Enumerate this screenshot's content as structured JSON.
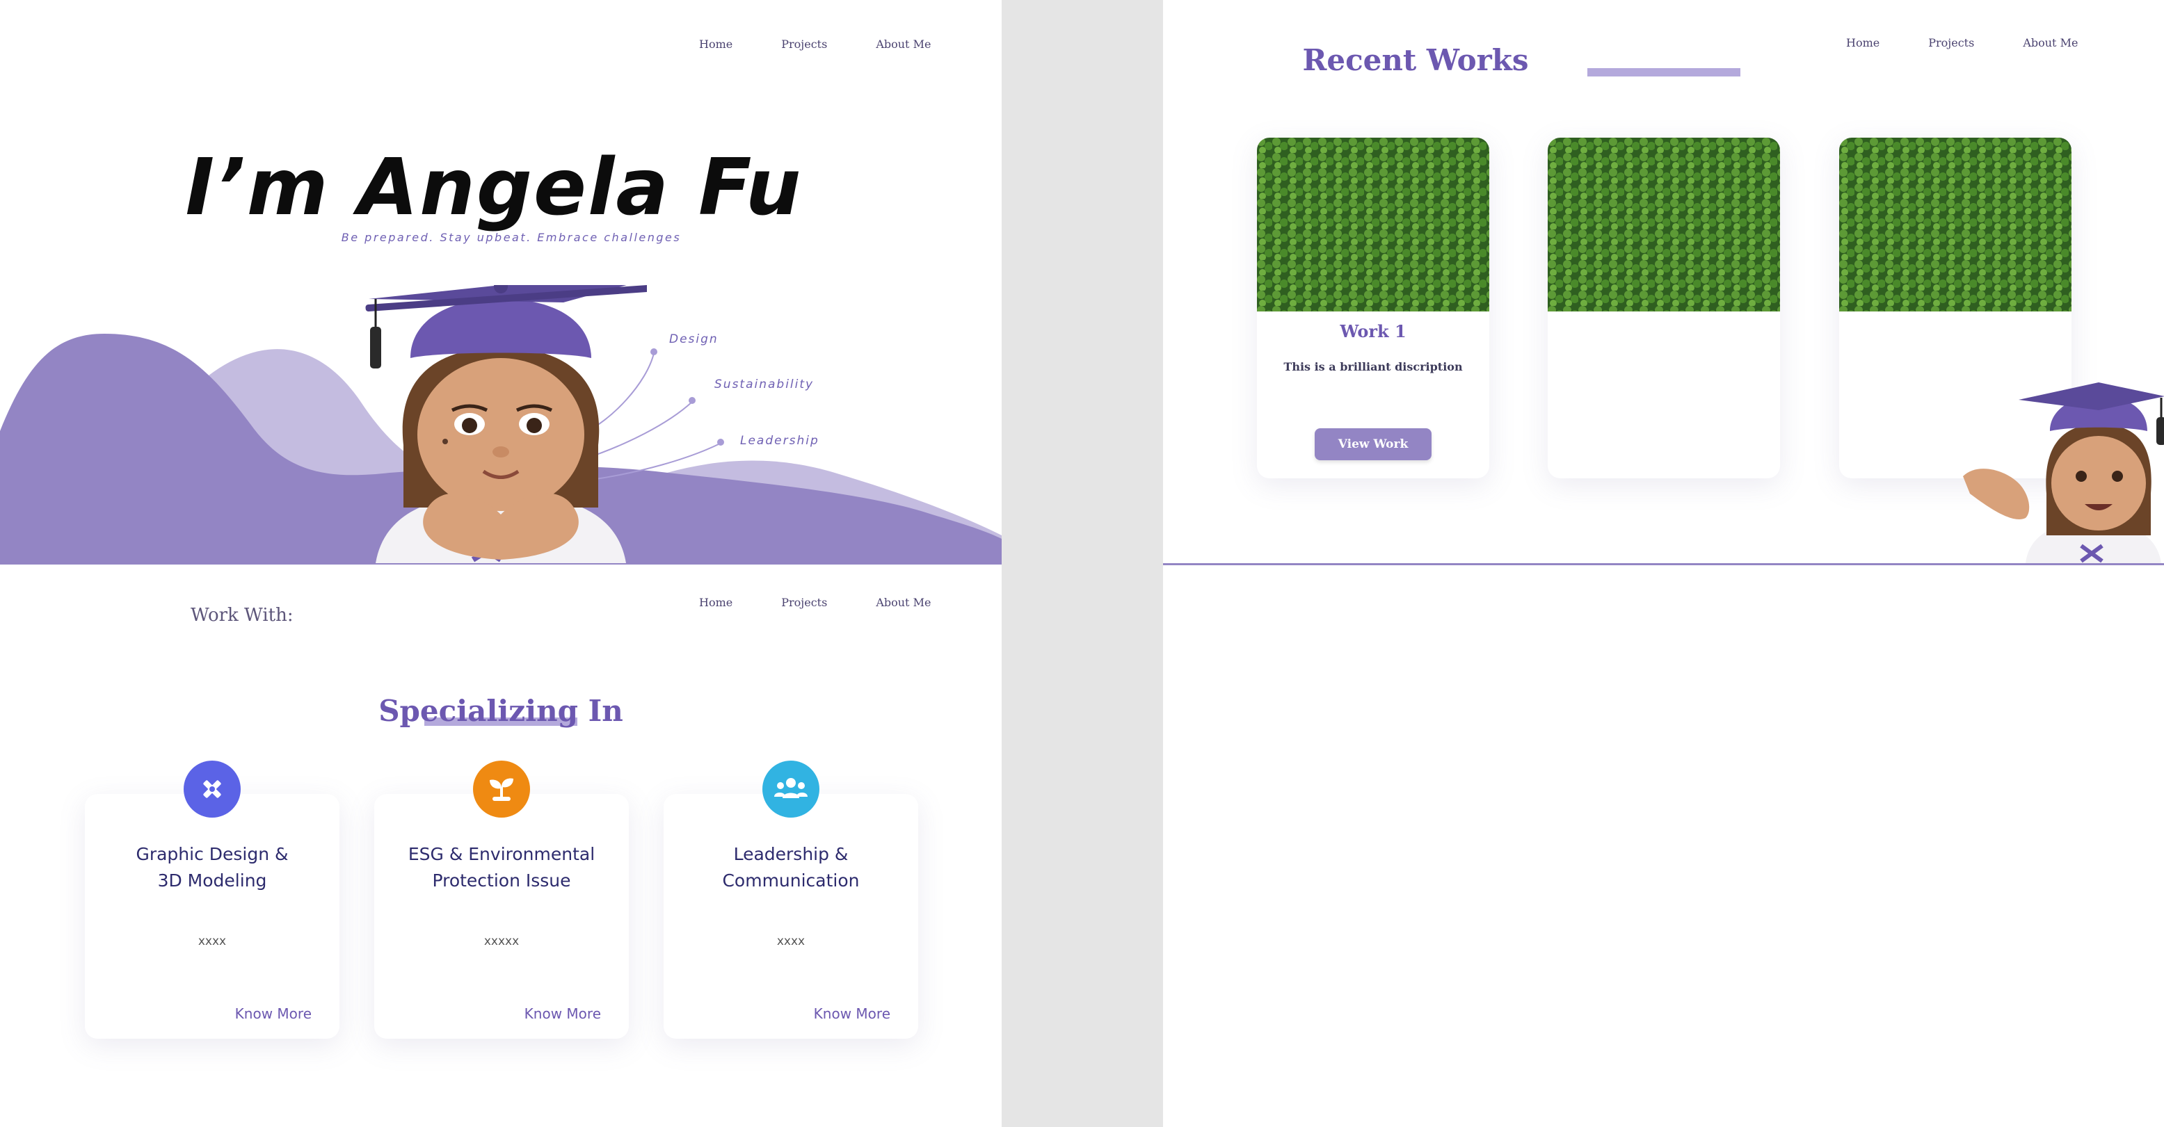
{
  "nav": {
    "home": "Home",
    "projects": "Projects",
    "about": "About Me"
  },
  "hero": {
    "title": "I’m Angela Fu",
    "subtitle": "Be prepared. Stay upbeat. Embrace challenges",
    "skills": [
      "Design",
      "Sustainability",
      "Leadership"
    ]
  },
  "specializing": {
    "work_with": "Work With:",
    "title": "Specializing In",
    "cards": [
      {
        "icon": "design-tools-icon",
        "title_1": "Graphic Design &",
        "title_2": "3D Modeling",
        "text": "xxxx",
        "link": "Know More"
      },
      {
        "icon": "sprout-icon",
        "title_1": "ESG & Environmental",
        "title_2": "Protection Issue",
        "text": "xxxxx",
        "link": "Know More"
      },
      {
        "icon": "team-icon",
        "title_1": "Leadership &",
        "title_2": "Communication",
        "text": "xxxx",
        "link": "Know More"
      }
    ]
  },
  "works": {
    "title": "Recent Works",
    "items": [
      {
        "title": "Work 1",
        "desc": "This is a brilliant discription",
        "button": "View Work"
      },
      {
        "title": "",
        "desc": "",
        "button": ""
      },
      {
        "title": "",
        "desc": "",
        "button": ""
      }
    ]
  },
  "colors": {
    "accent": "#6c58b0",
    "wave": "#9385c4",
    "wave_light": "#c4bce0",
    "icon_design": "#5b63e6",
    "icon_esg": "#ef8a12",
    "icon_team": "#31b3e2",
    "forest": "#3f7a2a"
  }
}
